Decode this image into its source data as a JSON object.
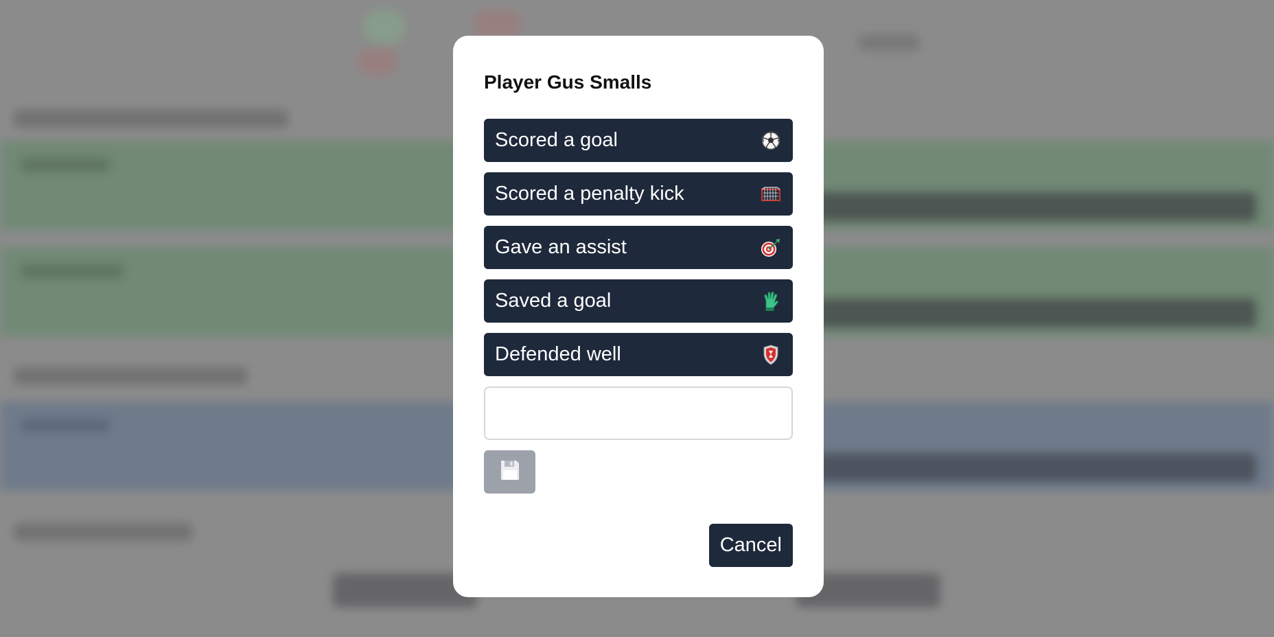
{
  "modal": {
    "title": "Player Gus Smalls",
    "actions": [
      {
        "label": "Scored a goal",
        "icon": "soccer-ball-icon"
      },
      {
        "label": "Scored a penalty kick",
        "icon": "goal-net-icon"
      },
      {
        "label": "Gave an assist",
        "icon": "target-dart-icon"
      },
      {
        "label": "Saved a goal",
        "icon": "goalkeeper-glove-icon"
      },
      {
        "label": "Defended well",
        "icon": "shield-icon"
      }
    ],
    "note_input": {
      "value": "",
      "placeholder": ""
    },
    "save_icon": "floppy-disk-icon",
    "cancel_label": "Cancel"
  },
  "colors": {
    "button_dark": "#1e293b",
    "save_disabled": "#9ca1aa",
    "backdrop": "#8f8f8f"
  }
}
